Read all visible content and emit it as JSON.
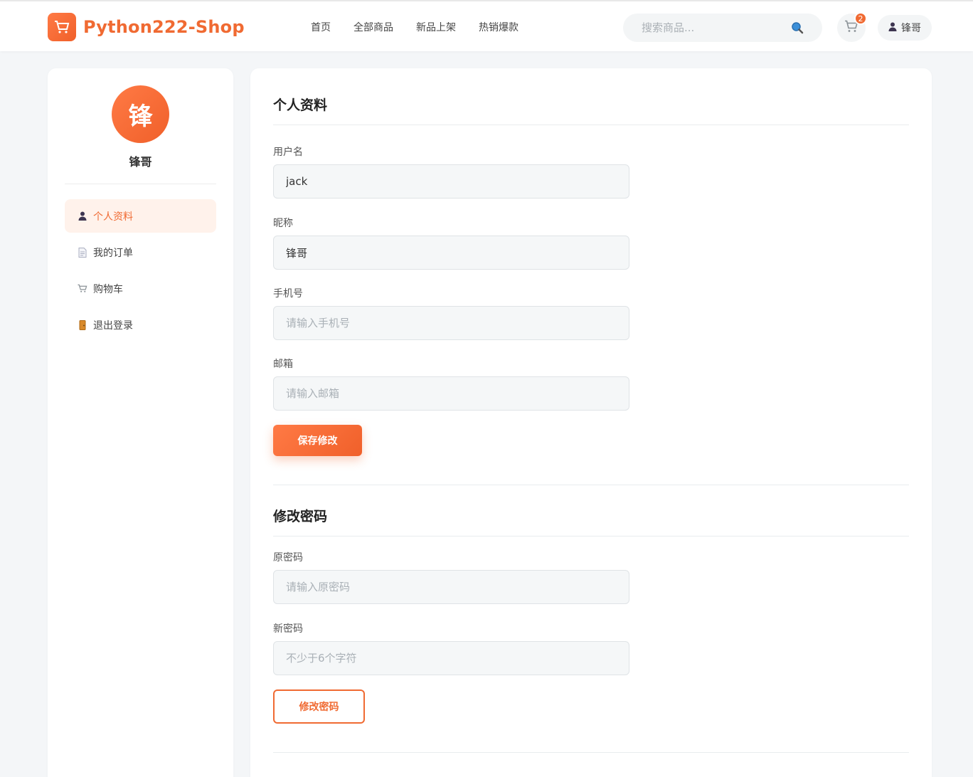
{
  "header": {
    "logo_text": "Python222-Shop",
    "nav": [
      "首页",
      "全部商品",
      "新品上架",
      "热销爆款"
    ],
    "search_placeholder": "搜索商品...",
    "cart_count": "2",
    "user_name": "锋哥"
  },
  "sidebar": {
    "avatar_char": "锋",
    "user_name": "锋哥",
    "items": [
      {
        "label": "个人资料",
        "icon": "person-icon",
        "active": true
      },
      {
        "label": "我的订单",
        "icon": "document-icon",
        "active": false
      },
      {
        "label": "购物车",
        "icon": "cart-icon",
        "active": false
      },
      {
        "label": "退出登录",
        "icon": "door-icon",
        "active": false
      }
    ]
  },
  "profile": {
    "title": "个人资料",
    "username_label": "用户名",
    "username_value": "jack",
    "nickname_label": "昵称",
    "nickname_value": "锋哥",
    "phone_label": "手机号",
    "phone_placeholder": "请输入手机号",
    "email_label": "邮箱",
    "email_placeholder": "请输入邮箱",
    "save_label": "保存修改"
  },
  "password": {
    "title": "修改密码",
    "old_label": "原密码",
    "old_placeholder": "请输入原密码",
    "new_label": "新密码",
    "new_placeholder": "不少于6个字符",
    "submit_label": "修改密码"
  },
  "colors": {
    "accent": "#f06a32",
    "active_bg": "#fff2eb"
  }
}
